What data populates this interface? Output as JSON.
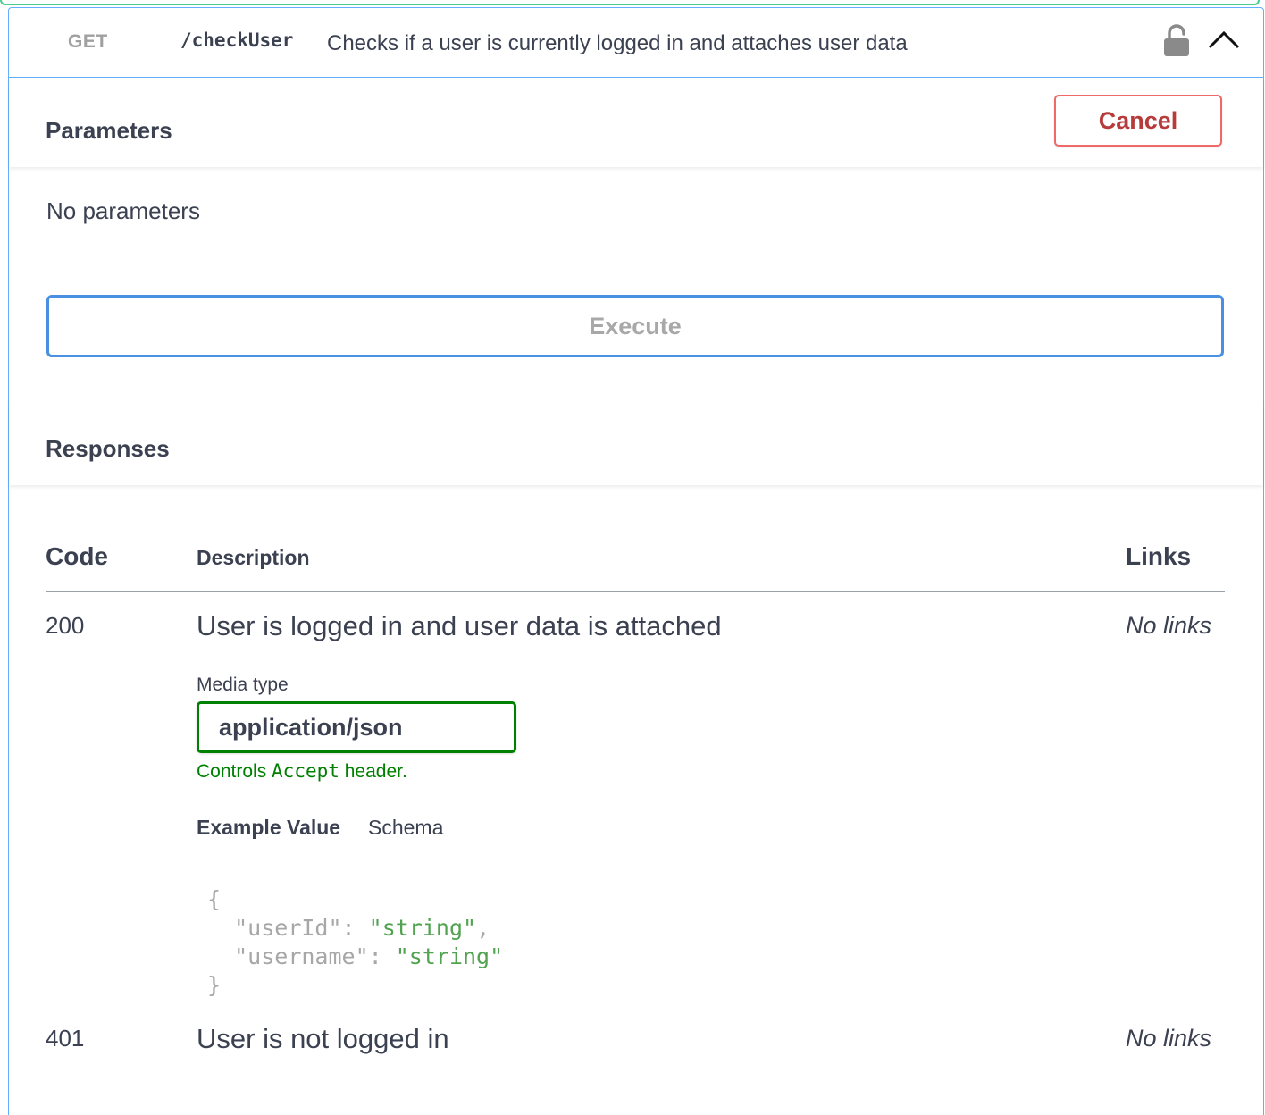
{
  "operation": {
    "method": "GET",
    "path": "/checkUser",
    "summary": "Checks if a user is currently logged in and attaches user data"
  },
  "icons": {
    "lock": "lock-icon",
    "collapse": "chevron-up-icon"
  },
  "parameters": {
    "title": "Parameters",
    "cancel_label": "Cancel",
    "empty_text": "No parameters"
  },
  "execute_label": "Execute",
  "responses": {
    "title": "Responses",
    "columns": {
      "code": "Code",
      "description": "Description",
      "links": "Links"
    },
    "rows": [
      {
        "code": "200",
        "description": "User is logged in and user data is attached",
        "links": "No links",
        "media_type_label": "Media type",
        "media_type": "application/json",
        "controls_prefix": "Controls ",
        "controls_code": "Accept",
        "controls_suffix": " header.",
        "tabs": {
          "example": "Example Value",
          "schema": "Schema"
        },
        "example": {
          "open": "{",
          "fields": [
            {
              "key": "\"userId\"",
              "value": "\"string\"",
              "trail": ","
            },
            {
              "key": "\"username\"",
              "value": "\"string\"",
              "trail": ""
            }
          ],
          "close": "}"
        }
      },
      {
        "code": "401",
        "description": "User is not logged in",
        "links": "No links"
      }
    ]
  },
  "colors": {
    "get_accent": "#61affe",
    "cancel": "#ef6969",
    "execute_border": "#4990e2",
    "media_border": "#008000",
    "json_string": "#51a351"
  }
}
